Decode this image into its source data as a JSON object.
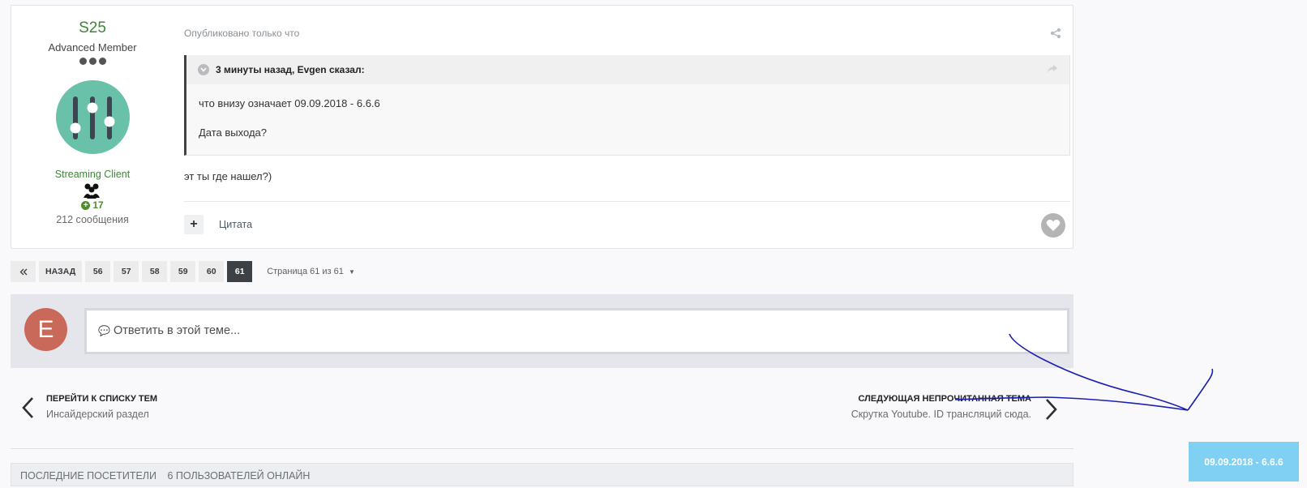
{
  "author": {
    "name": "S25",
    "rank": "Advanced Member",
    "group": "Streaming Client",
    "reputation": "17",
    "post_count": "212 сообщения"
  },
  "post": {
    "meta": "Опубликовано только что",
    "quote": {
      "header": "3 минуты назад, Evgen сказал:",
      "line1": "что внизу означает 09.09.2018 - 6.6.6",
      "line2": "Дата выхода?"
    },
    "body": "эт ты где нашел?)",
    "quote_label": "Цитата",
    "multiquote_label": "+"
  },
  "pagination": {
    "back": "НАЗАД",
    "pages": [
      "56",
      "57",
      "58",
      "59",
      "60",
      "61"
    ],
    "active": "61",
    "jump": "Страница 61 из 61"
  },
  "reply": {
    "avatar_letter": "E",
    "placeholder": "Ответить в этой теме..."
  },
  "navigation": {
    "prev_title": "ПЕРЕЙТИ К СПИСКУ ТЕМ",
    "prev_sub": "Инсайдерский раздел",
    "next_title": "СЛЕДУЮЩАЯ НЕПРОЧИТАННАЯ ТЕМА",
    "next_sub": "Скрутка Youtube. ID трансляций сюда."
  },
  "bottom": {
    "visitors": "Последние посетители",
    "online": "6 пользователей онлайн"
  },
  "toast": {
    "text": "09.09.2018 - 6.6.6"
  },
  "colors": {
    "accent_green": "#3f8438",
    "avatar_teal": "#6ac1a9",
    "reply_avatar": "#c9695a",
    "toast": "#7fd0f2",
    "scribble": "#1a1fb0"
  }
}
